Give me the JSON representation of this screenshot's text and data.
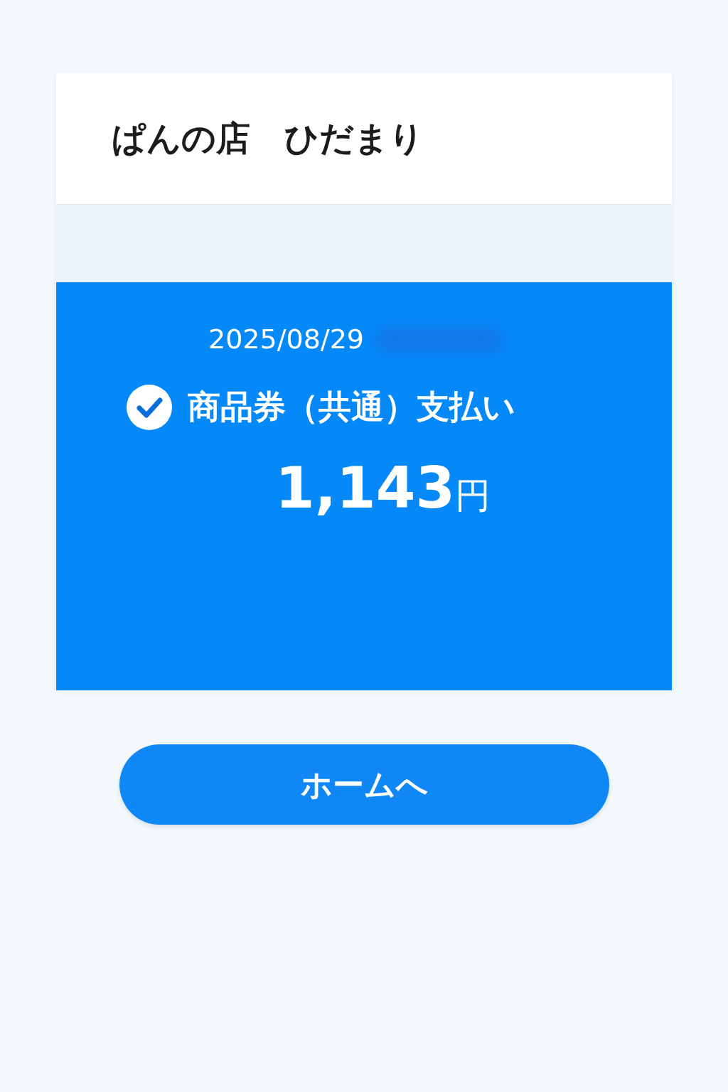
{
  "store_name": "ぱんの店　ひだまり",
  "payment": {
    "date": "2025/08/29",
    "title": "商品券（共通）支払い",
    "amount": "1,143",
    "currency": "円"
  },
  "button": {
    "label": "ホームへ"
  }
}
